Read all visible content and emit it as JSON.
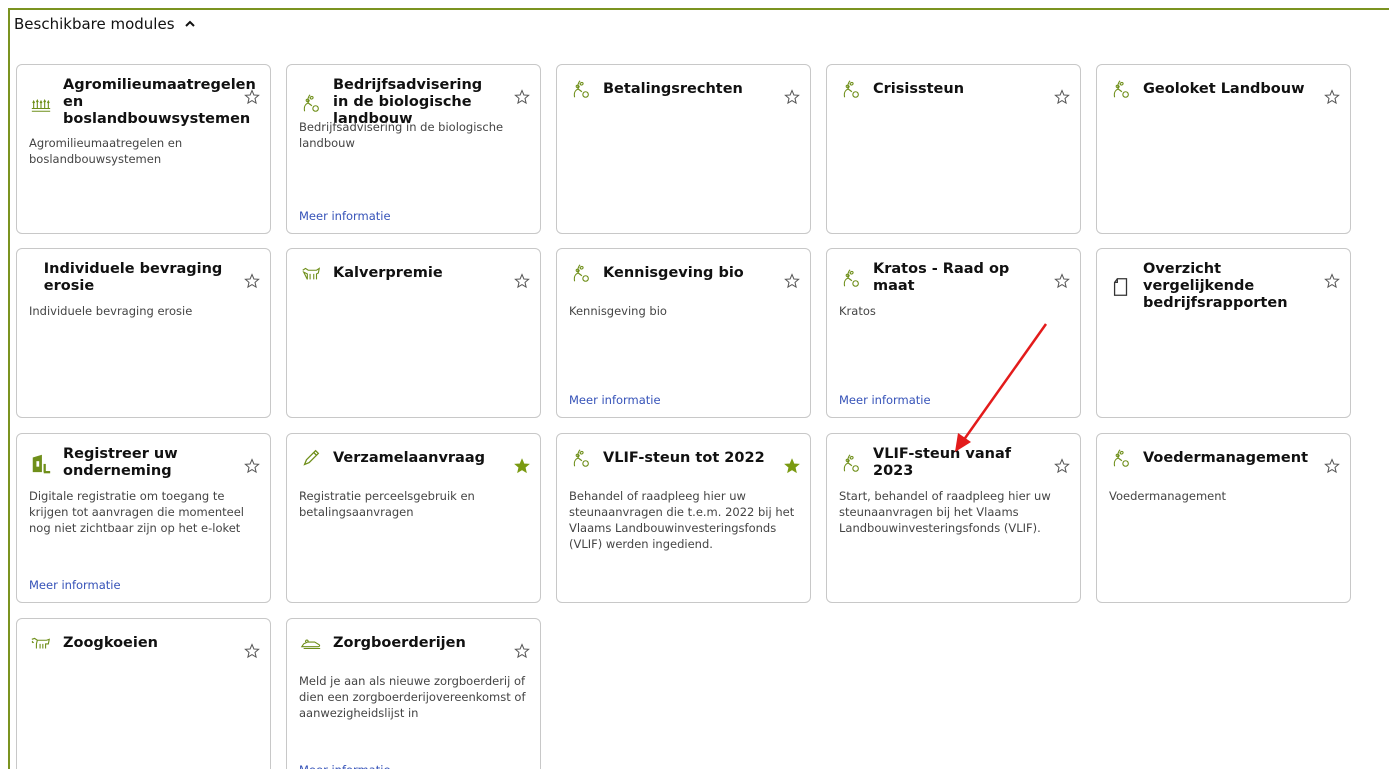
{
  "section": {
    "title": "Beschikbare modules",
    "expanded": true
  },
  "colors": {
    "accent_green": "#7b9320",
    "star_filled": "#7a9a12",
    "link_blue": "#3552b8",
    "annotation_red": "#e31b1b"
  },
  "cards": [
    {
      "title": "Agromilieumaatregelen en boslandbouwsystemen",
      "description": "Agromilieumaatregelen en boslandbouwsystemen",
      "more": "",
      "icon": "field-crops-icon",
      "favorite": false
    },
    {
      "title": "Bedrijfsadvisering in de biologische landbouw",
      "description": "Bedrijfsadvisering in de biologische landbouw",
      "more": "Meer informatie",
      "icon": "seedling-hand-icon",
      "favorite": false
    },
    {
      "title": "Betalingsrechten",
      "description": "",
      "more": "",
      "icon": "seedling-hand-icon",
      "favorite": false
    },
    {
      "title": "Crisissteun",
      "description": "",
      "more": "",
      "icon": "seedling-hand-icon",
      "favorite": false
    },
    {
      "title": "Geoloket Landbouw",
      "description": "",
      "more": "",
      "icon": "seedling-hand-icon",
      "favorite": false
    },
    {
      "title": "Individuele bevraging erosie",
      "description": "Individuele bevraging erosie",
      "more": "",
      "icon": "",
      "favorite": false
    },
    {
      "title": "Kalverpremie",
      "description": "",
      "more": "",
      "icon": "calf-icon",
      "favorite": false
    },
    {
      "title": "Kennisgeving bio",
      "description": "Kennisgeving bio",
      "more": "Meer informatie",
      "icon": "seedling-hand-icon",
      "favorite": false
    },
    {
      "title": "Kratos - Raad op maat",
      "description": "Kratos",
      "more": "Meer informatie",
      "icon": "seedling-hand-icon",
      "favorite": false
    },
    {
      "title": "Overzicht vergelijkende bedrijfsrapporten",
      "description": "",
      "more": "",
      "icon": "document-icon",
      "favorite": false
    },
    {
      "title": "Registreer uw onderneming",
      "description": "Digitale registratie om toegang te krijgen tot aanvragen die momenteel nog niet zichtbaar zijn op het e-loket",
      "more": "Meer informatie",
      "icon": "building-icon",
      "favorite": false
    },
    {
      "title": "Verzamelaanvraag",
      "description": "Registratie perceelsgebruik en betalingsaanvragen",
      "more": "",
      "icon": "pencil-icon",
      "favorite": true
    },
    {
      "title": "VLIF-steun tot 2022",
      "description": "Behandel of raadpleeg hier uw steunaanvragen die t.e.m. 2022 bij het Vlaams Landbouwinvesteringsfonds (VLIF) werden ingediend.",
      "more": "",
      "icon": "seedling-hand-icon",
      "favorite": true
    },
    {
      "title": "VLIF-steun vanaf 2023",
      "description": "Start, behandel of raadpleeg hier uw steunaanvragen bij het Vlaams Landbouwinvesteringsfonds (VLIF).",
      "more": "",
      "icon": "seedling-hand-icon",
      "favorite": false
    },
    {
      "title": "Voedermanagement",
      "description": "Voedermanagement",
      "more": "",
      "icon": "seedling-hand-icon",
      "favorite": false
    },
    {
      "title": "Zoogkoeien",
      "description": "",
      "more": "",
      "icon": "cow-icon",
      "favorite": false
    },
    {
      "title": "Zorgboerderijen",
      "description": "Meld je aan als nieuwe zorgboerderij of dien een zorgboerderijovereenkomst of aanwezigheidslijst in",
      "more": "Meer informatie",
      "icon": "care-farm-icon",
      "favorite": false
    }
  ]
}
